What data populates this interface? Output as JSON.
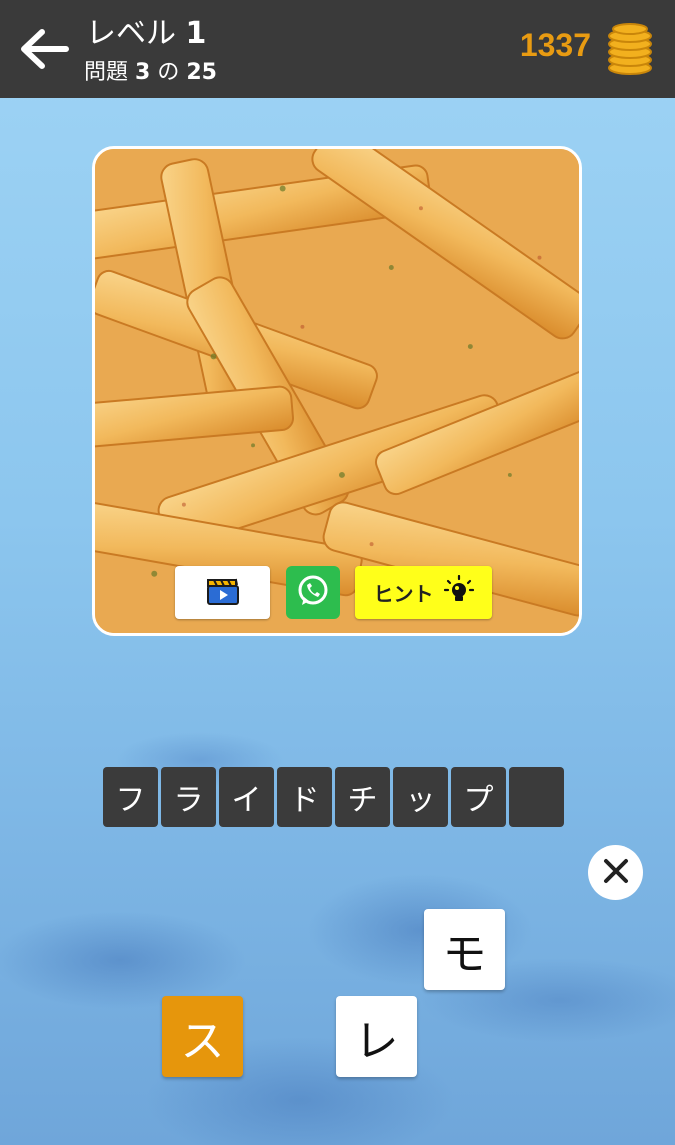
{
  "header": {
    "level_label": "レベル",
    "level_number": "1",
    "question_prefix": "問題",
    "question_current": "3",
    "question_sep": "の",
    "question_total": "25",
    "coins": "1337",
    "back_icon": "back-arrow-icon",
    "coins_icon": "coin-stack-icon"
  },
  "actions": {
    "video_icon": "video-clapper-icon",
    "whatsapp_icon": "whatsapp-icon",
    "hint_label": "ヒント",
    "hint_icon": "lightbulb-icon"
  },
  "answer": {
    "slots": [
      "フ",
      "ラ",
      "イ",
      "ド",
      "チ",
      "ッ",
      "プ",
      ""
    ]
  },
  "letters": {
    "tiles": [
      "モ",
      "ス",
      "レ"
    ],
    "clear_icon": "close-icon"
  },
  "colors": {
    "header_bg": "#3a3a3a",
    "coin_text": "#e89b12",
    "hint_bg": "#ffff1a",
    "whatsapp_bg": "#2dbd4e",
    "slot_bg": "#3b3b3b",
    "orange_tile": "#e6960c"
  }
}
